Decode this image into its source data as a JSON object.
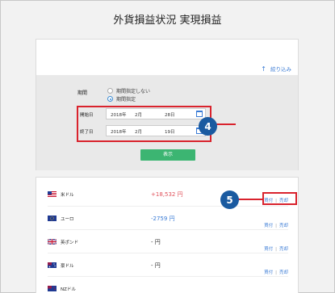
{
  "page": {
    "title": "外貨損益状況 実現損益"
  },
  "filter": {
    "toggle_label": "絞り込み",
    "toggle_icon": "up-arrow-icon",
    "period_label": "期間",
    "radio_options": [
      "期間指定しない",
      "期間指定"
    ],
    "selected_option": "期間指定",
    "start_label": "開始日",
    "start_date": {
      "year": "2018年",
      "month": "2月",
      "day": "28日"
    },
    "end_label": "終了日",
    "end_date": {
      "year": "2018年",
      "month": "2月",
      "day": "19日"
    },
    "calendar_icon": "calendar-icon",
    "show_button": "表示"
  },
  "callouts": {
    "badge4": "4",
    "badge5": "5"
  },
  "currencies": [
    {
      "name": "米ドル",
      "amount": "+18,532 円",
      "tone": "red",
      "flag": "us-flag-icon",
      "actions": [
        "買付",
        "売却"
      ]
    },
    {
      "name": "ユーロ",
      "amount": "-2759 円",
      "tone": "blue",
      "flag": "eu-flag-icon",
      "actions": [
        "買付",
        "売却"
      ]
    },
    {
      "name": "英ポンド",
      "amount": "- 円",
      "tone": "dark",
      "flag": "uk-flag-icon",
      "actions": [
        "買付",
        "売却"
      ]
    },
    {
      "name": "豪ドル",
      "amount": "- 円",
      "tone": "dark",
      "flag": "au-flag-icon",
      "actions": [
        "買付",
        "売却"
      ]
    },
    {
      "name": "NZドル",
      "amount": "",
      "tone": "dark",
      "flag": "nz-flag-icon",
      "actions": []
    }
  ],
  "colors": {
    "accent_blue": "#3a7bd5",
    "highlight_red": "#d9232d",
    "badge_blue": "#1a5aa0",
    "button_green": "#3cb572"
  }
}
